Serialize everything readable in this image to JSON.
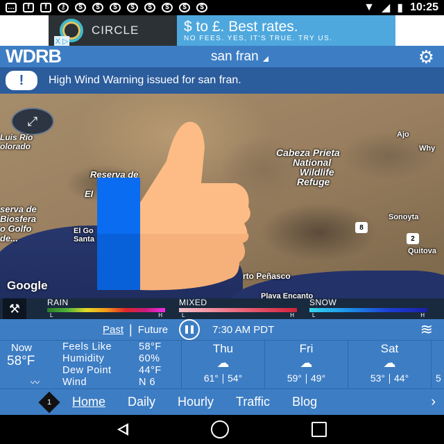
{
  "status_bar": {
    "time": "10:25",
    "notification_icons": [
      "message-icon",
      "facebook-icon",
      "facebook-icon",
      "key-icon",
      "dollar-icon",
      "dollar-icon",
      "dollar-icon",
      "dollar-icon",
      "dollar-icon",
      "dollar-icon",
      "dollar-icon",
      "dollar-icon"
    ],
    "system_icons": [
      "wifi-icon",
      "signal-icon",
      "battery-icon"
    ]
  },
  "ad": {
    "brand": "CIRCLE",
    "headline": "$ to £. Best rates.",
    "subline": "NO FEES. YES, IT'S TRUE. TRY US.",
    "close_glyph": "X ▷"
  },
  "header": {
    "logo": "WDRB",
    "location": "san fran"
  },
  "warning": {
    "badge": "!",
    "text": "High Wind Warning issued for san fran."
  },
  "map": {
    "labels": {
      "luis_rio": "Luis Río",
      "colorado": "olorado",
      "cabeza_prieta": "Cabeza Prieta",
      "national": "National",
      "wildlife": "Wildlife",
      "refuge": "Refuge",
      "reserva": "Reserva de",
      "reserva_2": "l",
      "reserva_3": "El",
      "biosfera_1": "serva de",
      "biosfera_2": "Biosfera",
      "biosfera_3": "o Golfo",
      "biosfera_4": "de...",
      "el_golfo": "El Go",
      "santa": "Santa",
      "ajo": "Ajo",
      "why": "Why",
      "sonoyta": "Sonoyta",
      "quitova": "Quitova",
      "puerto_penasco": "rto Peñasco",
      "playa_encanto": "Playa Encanto",
      "hwy_8": "8",
      "hwy_2": "2"
    },
    "attribution": "Google"
  },
  "legend": {
    "rain": {
      "title": "RAIN",
      "low": "L",
      "high": "H"
    },
    "mixed": {
      "title": "MIXED",
      "low": "L",
      "high": "H"
    },
    "snow": {
      "title": "SNOW",
      "low": "L",
      "high": "H"
    }
  },
  "forecast": {
    "past_label": "Past",
    "future_label": "Future",
    "time": "7:30 AM PDT",
    "now": {
      "label": "Now",
      "temp": "58°F"
    },
    "stats": [
      {
        "key": "Feels Like",
        "value": "58°F"
      },
      {
        "key": "Humidity",
        "value": "60%"
      },
      {
        "key": "Dew Point",
        "value": "44°F"
      },
      {
        "key": "Wind",
        "value": "N 6"
      }
    ],
    "days": [
      {
        "name": "Thu",
        "high": "61°",
        "low": "54°"
      },
      {
        "name": "Fri",
        "high": "59°",
        "low": "49°"
      },
      {
        "name": "Sat",
        "high": "53°",
        "low": "44°"
      }
    ],
    "partial_day_high": "5"
  },
  "nav": {
    "badge": "1",
    "items": [
      "Home",
      "Daily",
      "Hourly",
      "Traffic",
      "Blog"
    ],
    "more": "›"
  },
  "colors": {
    "brand_blue": "#3d7dc4",
    "warning_bg": "#2b5c9c",
    "thumb_skin": "#fdbc85",
    "thumb_cuff": "#0a6cf0"
  }
}
